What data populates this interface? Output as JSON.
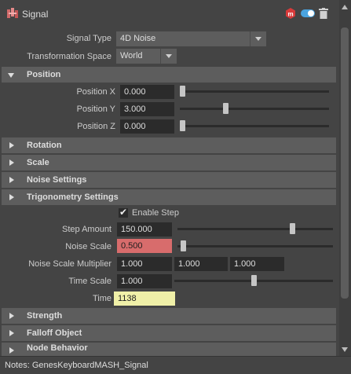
{
  "header": {
    "title": "Signal",
    "icons": [
      "mash-node-icon",
      "red-hexagon-icon",
      "toggle-icon",
      "trash-icon"
    ]
  },
  "signal_type": {
    "label": "Signal Type",
    "value": "4D Noise"
  },
  "transformation_space": {
    "label": "Transformation Space",
    "value": "World"
  },
  "sections": {
    "position": "Position",
    "rotation": "Rotation",
    "scale": "Scale",
    "noise_settings": "Noise Settings",
    "trigonometry": "Trigonometry Settings",
    "strength": "Strength",
    "falloff": "Falloff Object",
    "node_behavior": "Node Behavior"
  },
  "position": {
    "x": {
      "label": "Position X",
      "value": "0.000",
      "slider": 0.0
    },
    "y": {
      "label": "Position Y",
      "value": "3.000",
      "slider": 0.3
    },
    "z": {
      "label": "Position Z",
      "value": "0.000",
      "slider": 0.0
    }
  },
  "step": {
    "enable_label": "Enable Step",
    "enabled": true,
    "amount_label": "Step Amount",
    "amount_value": "150.000",
    "amount_slider": 0.75
  },
  "noise_scale": {
    "label": "Noise Scale",
    "value": "0.500",
    "slider": 0.02
  },
  "noise_scale_multiplier": {
    "label": "Noise Scale Multiplier",
    "values": [
      "1.000",
      "1.000",
      "1.000"
    ]
  },
  "time_scale": {
    "label": "Time Scale",
    "value": "1.000",
    "slider": 0.5
  },
  "time": {
    "label": "Time",
    "value": "1138"
  },
  "notes": {
    "text": "Notes:  GenesKeyboardMASH_Signal"
  },
  "colors": {
    "keyed_field": "#f0f0a8",
    "locked_field": "#d86c6c",
    "accent_red": "#d83a3a",
    "toggle_blue": "#4aa3df"
  }
}
